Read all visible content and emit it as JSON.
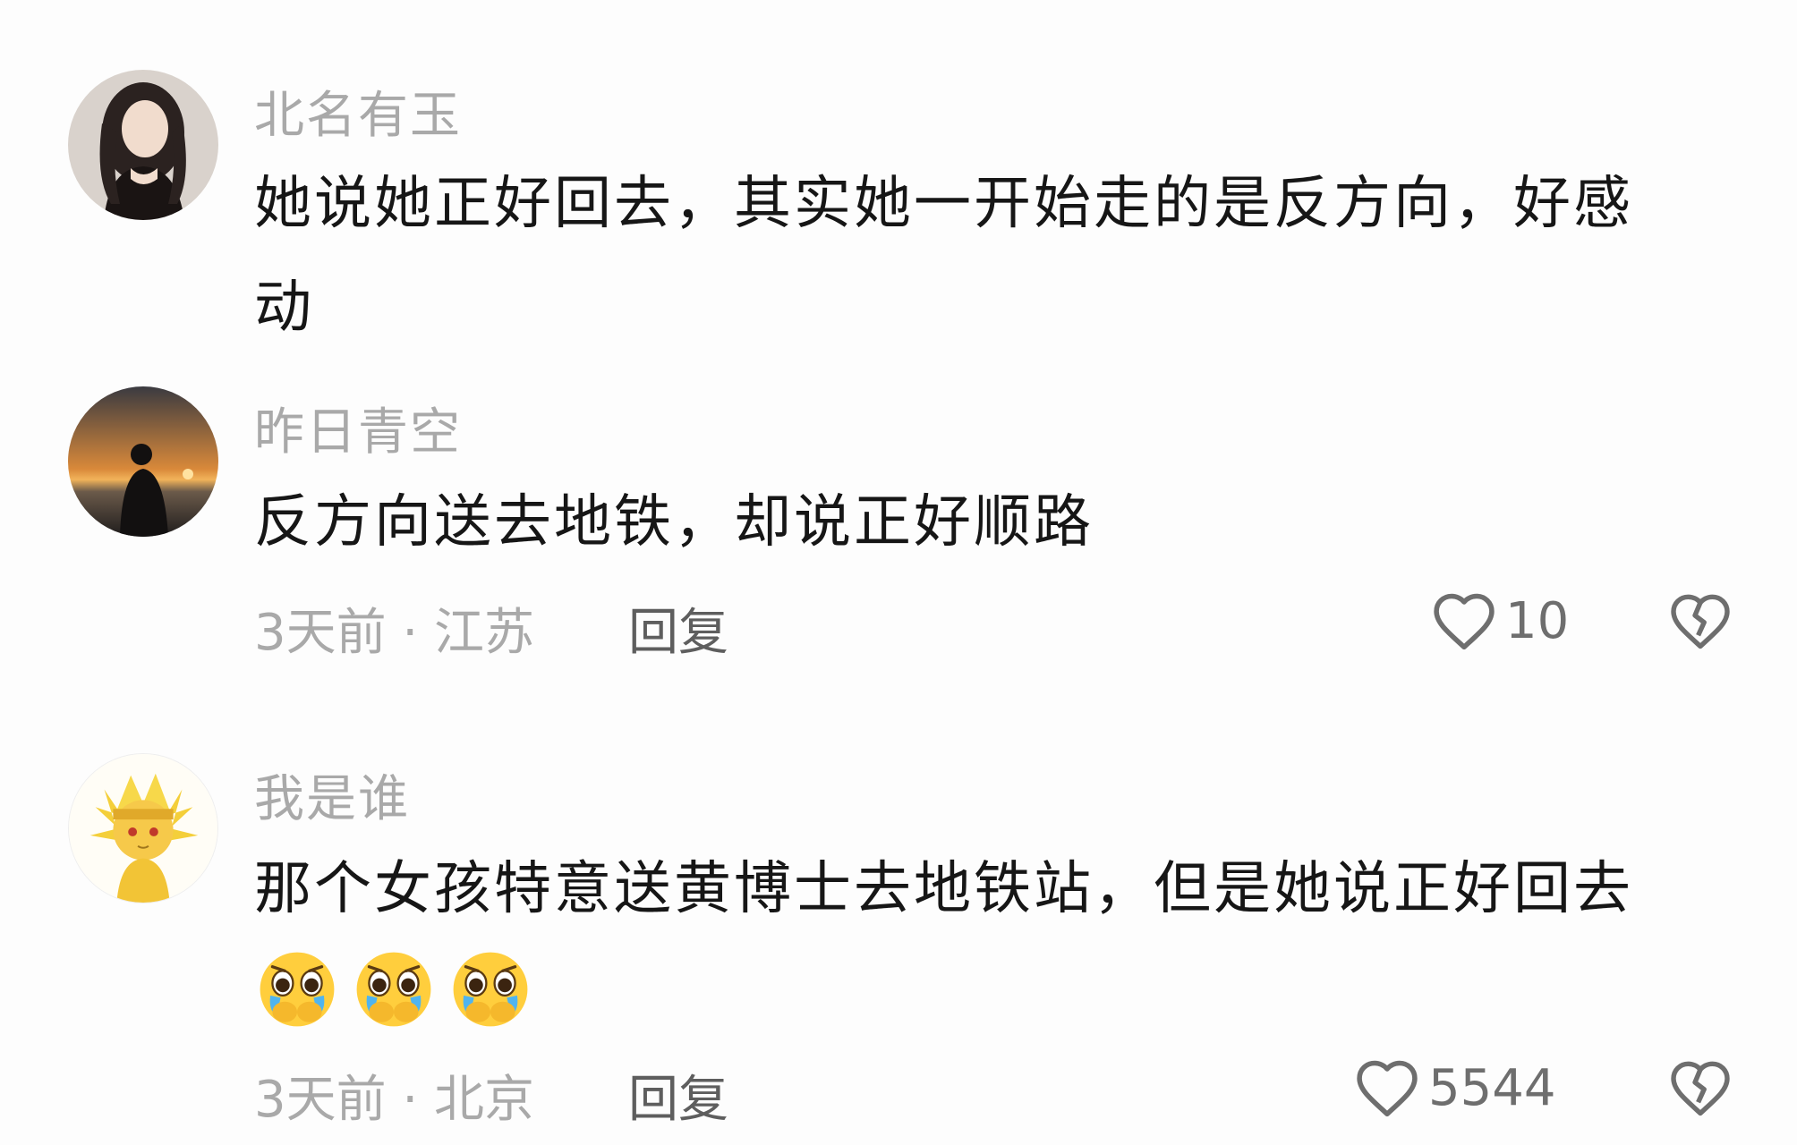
{
  "comments": [
    {
      "username": "北名有玉",
      "content_line1": "她说她正好回去，其实她一开始走的是反方向，好感",
      "content_line2": "动",
      "avatar_icon": "avatar-woman-dark-hair"
    },
    {
      "username": "昨日青空",
      "content": "反方向送去地铁，却说正好顺路",
      "meta": "3天前 · 江苏",
      "reply_label": "回复",
      "like_count": "10",
      "avatar_icon": "avatar-sunset-silhouette"
    },
    {
      "username": "我是谁",
      "content": "那个女孩特意送黄博士去地铁站，但是她说正好回去",
      "emojis": [
        "pleading-crying-emoji",
        "pleading-crying-emoji",
        "pleading-crying-emoji"
      ],
      "meta": "3天前 · 北京",
      "reply_label": "回复",
      "like_count": "5544",
      "avatar_icon": "avatar-golden-anime-character"
    }
  ],
  "icons": {
    "like": "heart-outline-icon",
    "dislike": "broken-heart-icon"
  },
  "colors": {
    "background": "#fdfdfd",
    "username": "#a9a9a9",
    "content": "#161616",
    "meta": "#a9a9a9",
    "reply": "#5e5e5e",
    "icon": "#6e6e6e"
  }
}
